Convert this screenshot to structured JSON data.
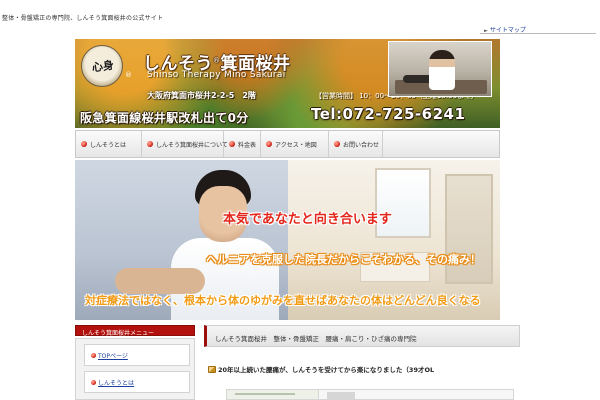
{
  "topbar": {
    "tagline": "整体・骨盤矯正の専門院、しんそう箕面桜井の公式サイト",
    "sitemap_label": "サイトマップ"
  },
  "header": {
    "logo_text": "心身",
    "title_jp": "しんそう",
    "title_jp_suffix": "箕面桜井",
    "reg_mark": "®",
    "title_en": "Shinso Therapy Mino Sakurai",
    "address": "大阪府箕面市桜井2-2-5　2階",
    "hours": "【営業時間】 10：00～20：00（土曜18:00まで）",
    "station": "阪急箕面線桜井駅改札出て0分",
    "tel": "Tel:072-725-6241"
  },
  "nav": {
    "items": [
      {
        "label": "しんそうとは"
      },
      {
        "label": "しんそう箕面桜井について"
      },
      {
        "label": "料金表"
      },
      {
        "label": "アクセス・地図"
      },
      {
        "label": "お問い合わせ"
      }
    ]
  },
  "hero": {
    "headline": "本気であなたと向き合います",
    "subline": "ヘルニアを克服した院長だからこそわかる、その痛み！",
    "bottomline": "対症療法ではなく、根本から体のゆがみを直せばあなたの体はどんどん良くなる"
  },
  "sidebar": {
    "header": "しんそう箕面桜井メニュー",
    "links": [
      {
        "label": "TOPページ"
      },
      {
        "label": "しんそうとは"
      }
    ]
  },
  "main": {
    "title": "しんそう箕面桜井　整体・骨盤矯正　腰痛・肩こり・ひざ痛の専門院",
    "post_title": "20年以上続いた腰痛が、しんそうを受けてから楽になりました（39才OL"
  }
}
